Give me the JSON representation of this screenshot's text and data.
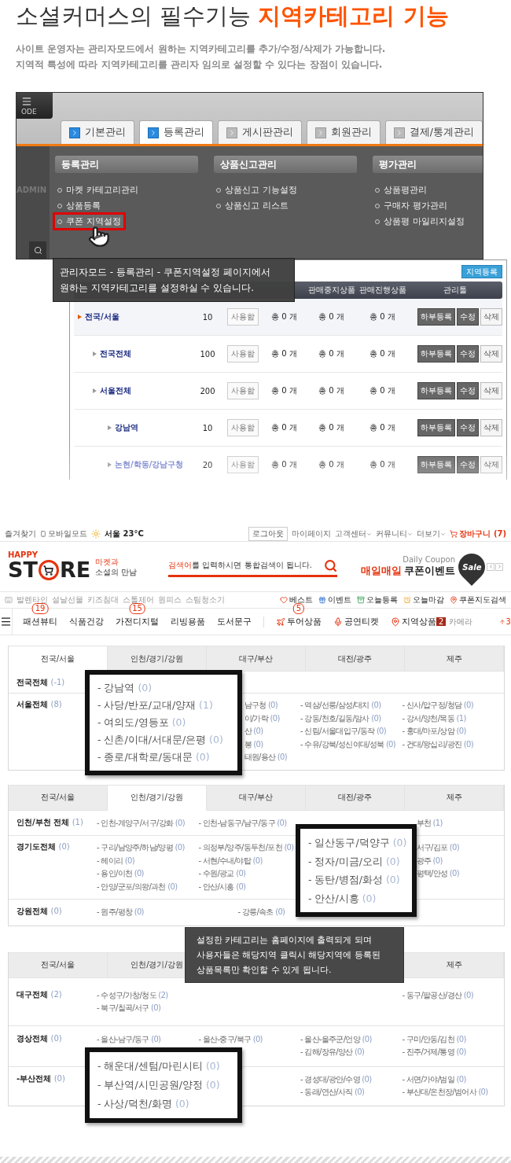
{
  "intro": {
    "title": "소셜커머스의 필수기능",
    "title_highlight": "지역카테고리 기능",
    "lines": [
      "사이트 운영자는 관리자모드에서 원하는 지역카테고리를 추가/수정/삭제가 가능합니다.",
      "지역적 특성에 따라 지역카테고리를 관리자 임의로 설정할 수 있다는 장점이 있습니다."
    ]
  },
  "admin": {
    "logo_text": "ODE",
    "side_label": "ADMIN",
    "tabs": [
      {
        "label": "기본관리",
        "selected": false,
        "icon_lit": true
      },
      {
        "label": "등록관리",
        "selected": true,
        "icon_lit": true
      },
      {
        "label": "게시판관리",
        "selected": false,
        "icon_lit": false
      },
      {
        "label": "회원관리",
        "selected": false,
        "icon_lit": false
      },
      {
        "label": "결제/통계관리",
        "selected": false,
        "icon_lit": false
      }
    ],
    "menus": [
      {
        "title": "등록관리",
        "items": [
          {
            "label": "마켓 카테고리관리",
            "highlighted": false
          },
          {
            "label": "상품등록",
            "highlighted": false
          },
          {
            "label": "쿠폰 지역설정",
            "highlighted": true
          }
        ]
      },
      {
        "title": "상품신고관리",
        "items": [
          {
            "label": "상품신고 기능설정",
            "highlighted": false
          },
          {
            "label": "상품신고 리스트",
            "highlighted": false
          }
        ]
      },
      {
        "title": "평가관리",
        "items": [
          {
            "label": "상품평관리",
            "highlighted": false
          },
          {
            "label": "구매자 평가관리",
            "highlighted": false
          },
          {
            "label": "상품평 마일리지설정",
            "highlighted": false
          }
        ]
      }
    ],
    "callout": [
      "관리자모드 - 등록관리 - 쿠폰지역설정 페이지에서",
      "원하는 지역카테고리를 설정하실 수 있습니다."
    ],
    "table": {
      "add_button": "지역등록",
      "columns": [
        "판매중지상품",
        "판매진행상품",
        "관리툴"
      ],
      "rows": [
        {
          "name": "전국/서울",
          "order": "10",
          "use": "사용함",
          "counts": [
            "총 0 개",
            "총 0 개",
            "총 0 개"
          ],
          "actions": [
            "하부등록",
            "수정",
            "삭제"
          ],
          "children": [
            {
              "name": "전국전체",
              "order": "100",
              "use": "사용함",
              "counts": [
                "총 0 개",
                "총 0 개",
                "총 0 개"
              ],
              "actions": [
                "하부등록",
                "수정",
                "삭제"
              ]
            },
            {
              "name": "서울전체",
              "order": "200",
              "use": "사용함",
              "counts": [
                "총 0 개",
                "총 0 개",
                "총 0 개"
              ],
              "actions": [
                "하부등록",
                "수정",
                "삭제"
              ],
              "children": [
                {
                  "name": "강남역",
                  "order": "10",
                  "use": "사용함",
                  "counts": [
                    "총 0 개",
                    "총 0 개",
                    "총 0 개"
                  ],
                  "actions": [
                    "하부등록",
                    "수정",
                    "삭제"
                  ]
                },
                {
                  "name": "논현/학동/강남구청",
                  "order": "20",
                  "use": "사용함",
                  "counts": [
                    "총 0 개",
                    "총 0 개",
                    "총 0 개"
                  ],
                  "actions": [
                    "하부등록",
                    "수정",
                    "삭제"
                  ]
                }
              ]
            }
          ]
        }
      ]
    }
  },
  "store": {
    "bookmark": "즐겨찾기",
    "mobile": "모바일모드",
    "weather": "서울 23°C",
    "logout": "로그아웃",
    "links": [
      "마이페이지",
      "고객센터",
      "커뮤니티",
      "더보기"
    ],
    "cart": "장바구니 (7)",
    "logo_top": "HAPPY",
    "logo_left": "ST",
    "logo_right": "RE",
    "tagline": [
      "마켓과",
      "소셜의 만남"
    ],
    "search_highlight": "검색어",
    "search_rest": "를 입력하시면 통합검색이 됩니다.",
    "coupon_sub": "Daily Coupon",
    "coupon_highlight": "매일매일",
    "coupon_title": "쿠폰이벤트",
    "sale": "Sale",
    "quick": [
      "발렌타인",
      "설날선물",
      "키즈침대",
      "스톨체어",
      "원피스",
      "스팀청소기"
    ],
    "shortcuts": [
      {
        "kind": "heart",
        "label": "베스트"
      },
      {
        "kind": "gift",
        "label": "이벤트"
      },
      {
        "kind": "box",
        "label": "오늘등록"
      },
      {
        "kind": "alarm",
        "label": "오늘마감"
      },
      {
        "kind": "map",
        "label": "쿠폰지도검색"
      }
    ],
    "nav": [
      {
        "kind": "plain",
        "label": "패션뷰티",
        "badge": "19"
      },
      {
        "kind": "plain",
        "label": "식품건강"
      },
      {
        "kind": "plain",
        "label": "가전디지털",
        "badge": "15"
      },
      {
        "kind": "plain",
        "label": "리빙용품"
      },
      {
        "kind": "plain",
        "label": "도서문구"
      },
      {
        "kind": "plane",
        "label": "투어상품",
        "badge": "5"
      },
      {
        "kind": "mic",
        "label": "공연티켓"
      },
      {
        "kind": "pin",
        "label": "지역상품"
      }
    ],
    "ranking": {
      "rank": "2",
      "label": "카메라",
      "change": "3"
    }
  },
  "region_panels": [
    {
      "tabs": [
        {
          "label": "전국/서울",
          "selected": true
        },
        {
          "label": "인천/경기/강원",
          "selected": false
        },
        {
          "label": "대구/부산",
          "selected": false
        },
        {
          "label": "대전/광주",
          "selected": false
        },
        {
          "label": "제주",
          "selected": false
        }
      ],
      "rows": [
        {
          "title": "전국전체",
          "count": "(-1)",
          "columns": [
            [],
            [],
            [],
            []
          ]
        },
        {
          "title": "서울전체",
          "count": "(8)",
          "columns": [
            [],
            [
              {
                "name": "남구청",
                "count": "(0)"
              },
              {
                "name": "이/가락",
                "count": "(0)"
              },
              {
                "name": "산",
                "count": "(0)"
              },
              {
                "name": "봉",
                "count": "(0)"
              },
              {
                "name": "태원/용산",
                "count": "(0)"
              }
            ],
            [
              {
                "name": "- 역삼/선릉/삼성/대치",
                "count": "(0)"
              },
              {
                "name": "- 강동/천호/길동/암사",
                "count": "(0)"
              },
              {
                "name": "- 신림/서울대입구/동작",
                "count": "(0)"
              },
              {
                "name": "- 수유/강북/성신여대/성북",
                "count": "(0)"
              }
            ],
            [
              {
                "name": "- 신사/압구정/청담",
                "count": "(0)"
              },
              {
                "name": "- 강서/양천/목동",
                "count": "(1)"
              },
              {
                "name": "- 홍대/마포/상암",
                "count": "(0)"
              },
              {
                "name": "- 건대/왕십리/광진",
                "count": "(0)"
              }
            ]
          ]
        }
      ],
      "popup": [
        {
          "name": "- 강남역",
          "count": "(0)"
        },
        {
          "name": "- 사당/반포/교대/양재",
          "count": "(1)"
        },
        {
          "name": "- 여의도/영등포",
          "count": "(0)"
        },
        {
          "name": "- 신촌/이대/서대문/은평",
          "count": "(0)"
        },
        {
          "name": "- 종로/대학로/동대문",
          "count": "(0)"
        }
      ]
    },
    {
      "tabs": [
        {
          "label": "전국/서울",
          "selected": false
        },
        {
          "label": "인천/경기/강원",
          "selected": true
        },
        {
          "label": "대구/부산",
          "selected": false
        },
        {
          "label": "대전/광주",
          "selected": false
        },
        {
          "label": "제주",
          "selected": false
        }
      ],
      "rows": [
        {
          "title": "인천/부천 전체",
          "count": "(1)",
          "columns": [
            [
              {
                "name": "- 인천-계양구/서구/강화",
                "count": "(0)"
              }
            ],
            [
              {
                "name": "- 인천-남동구/남구/동구",
                "count": "(0)"
              }
            ],
            [],
            [
              {
                "name": "부천",
                "count": "(1)"
              }
            ]
          ]
        },
        {
          "title": "경기도전체",
          "count": "(0)",
          "columns": [
            [
              {
                "name": "- 구리/남양주/하남/양평",
                "count": "(0)"
              },
              {
                "name": "- 헤이리",
                "count": "(0)"
              },
              {
                "name": "- 용인/이천",
                "count": "(0)"
              },
              {
                "name": "- 안양/군포/의왕/과천",
                "count": "(0)"
              }
            ],
            [
              {
                "name": "- 의정부/양주/동두천/포천",
                "count": "(0)"
              },
              {
                "name": "- 서현/수내/야탑",
                "count": "(0)"
              },
              {
                "name": "- 수원/광교",
                "count": "(0)"
              },
              {
                "name": "- 안산/시흥",
                "count": "(0)"
              }
            ],
            [],
            [
              {
                "name": "서구/김포",
                "count": "(0)"
              },
              {
                "name": "광주",
                "count": "(0)"
              },
              {
                "name": "평택/안성",
                "count": "(0)"
              }
            ]
          ]
        },
        {
          "title": "강원전체",
          "count": "(0)",
          "columns": [
            [
              {
                "name": "- 원주/평창",
                "count": "(0)"
              }
            ],
            [
              {
                "name": "- 강릉/속초",
                "count": "(0)"
              }
            ],
            [],
            []
          ]
        }
      ],
      "popup": [
        {
          "name": "- 일산동구/덕양구",
          "count": "(0)"
        },
        {
          "name": "- 정자/미금/오리",
          "count": "(0)"
        },
        {
          "name": "- 동탄/병점/화성",
          "count": "(0)"
        },
        {
          "name": "- 안산/시흥",
          "count": "(0)"
        }
      ]
    },
    {
      "tabs": [
        {
          "label": "전국/서울",
          "selected": false
        },
        {
          "label": "인천/경기/강원",
          "selected": false
        },
        {
          "label": "제주",
          "selected": false
        }
      ],
      "rows": [
        {
          "title": "대구전체",
          "count": "(2)",
          "columns": [
            [
              {
                "name": "- 수성구/가창/청도",
                "count": "(2)"
              },
              {
                "name": "- 북구/칠곡/서구",
                "count": "(0)"
              }
            ],
            [],
            [],
            [
              {
                "name": "- 동구/팔공산/경산",
                "count": "(0)"
              }
            ]
          ]
        },
        {
          "title": "경상전체",
          "count": "(0)",
          "columns": [
            [
              {
                "name": "- 울산-남구/동구",
                "count": "(0)"
              }
            ],
            [
              {
                "name": "- 울산-중구/북구",
                "count": "(0)"
              }
            ],
            [
              {
                "name": "- 울산-울주군/언양",
                "count": "(0)"
              },
              {
                "name": "- 김해/장유/양산",
                "count": "(0)"
              }
            ],
            [
              {
                "name": "- 구미/안동/김천",
                "count": "(0)"
              },
              {
                "name": "- 진주/거제/통영",
                "count": "(0)"
              }
            ]
          ]
        },
        {
          "title": "-부산전체",
          "count": "(0)",
          "columns": [
            [],
            [],
            [
              {
                "name": "- 경성대/광안/수영",
                "count": "(0)"
              },
              {
                "name": "- 동래/연산/사직",
                "count": "(0)"
              }
            ],
            [
              {
                "name": "- 서면/가야/범일",
                "count": "(0)"
              },
              {
                "name": "- 부산대/온천장/범어사",
                "count": "(0)"
              }
            ]
          ]
        }
      ],
      "popup": [
        {
          "name": "- 해운대/센텀/마린시티",
          "count": "(0)"
        },
        {
          "name": "- 부산역/시민공원/양정",
          "count": "(0)"
        },
        {
          "name": "- 사상/덕천/화명",
          "count": "(0)"
        }
      ]
    }
  ],
  "notice": [
    "설정한 카테고리는 홈페이지에 출력되게 되며",
    "사용자들은 해당지역 클릭시 해당지역에 등록된",
    "상품목록만 확인할 수 있게 됩니다."
  ]
}
